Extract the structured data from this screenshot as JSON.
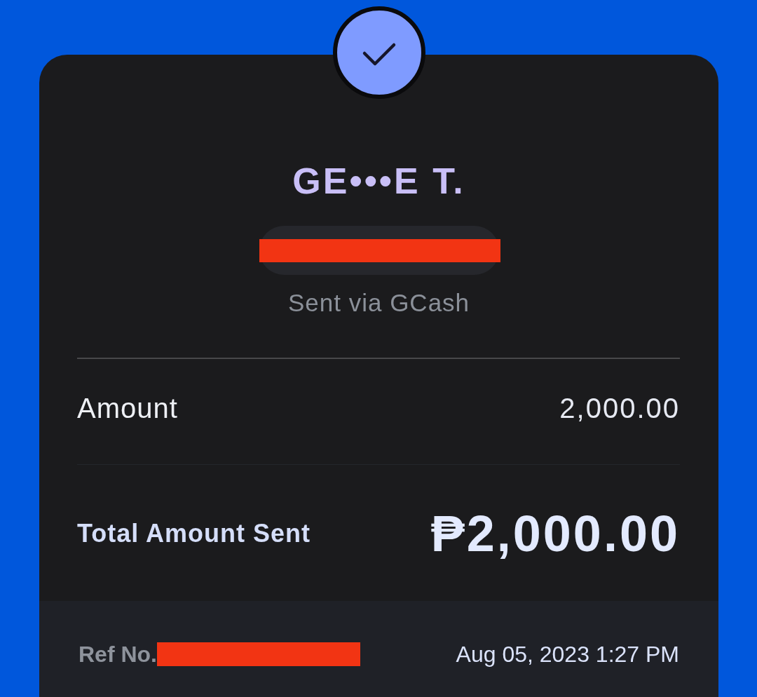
{
  "status": {
    "kind": "success"
  },
  "recipient": {
    "name": "GE•••E T.",
    "number_redacted": true,
    "via": "Sent via GCash"
  },
  "details": [
    {
      "kind": "normal",
      "label": "Amount",
      "value": "2,000.00"
    },
    {
      "kind": "total",
      "label": "Total Amount Sent",
      "value": "₱2,000.00"
    }
  ],
  "footer": {
    "ref_label": "Ref No.",
    "ref_redacted": true,
    "timestamp": "Aug 05, 2023 1:27 PM"
  }
}
